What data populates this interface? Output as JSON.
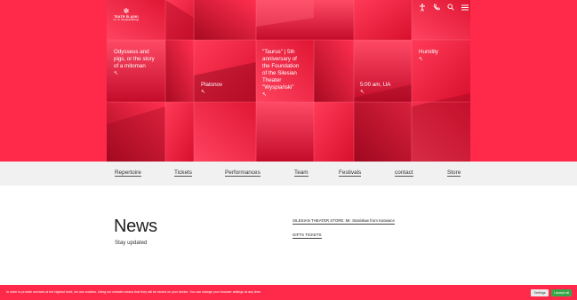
{
  "logo": {
    "line1": "TEATR ŚLĄSKI",
    "line2": "im. S. Wyspiańskiego"
  },
  "header_icons": [
    "accessibility-icon",
    "phone-icon",
    "search-icon",
    "menu-icon"
  ],
  "shows": [
    {
      "title": "Odysseus and pigs, or the story of a mitoman",
      "arrow": "↖"
    },
    {
      "title": "Platonov",
      "arrow": "↖"
    },
    {
      "title": "\"Taurus\" | 5th anniversary of the Foundation of the Silesian Theater \"Wyspiański\"",
      "arrow": "↖"
    },
    {
      "title": "5:00 am, UA",
      "arrow": "↖"
    },
    {
      "title": "Humility",
      "arrow": "↖"
    }
  ],
  "nav": [
    "Repertoire",
    "Tickets",
    "Performances",
    "Team",
    "Festivals",
    "contact",
    "Store"
  ],
  "news": {
    "title": "News",
    "subtitle": "Stay updated",
    "links": [
      "SILESIAN THEATER STORE: Mr. Stanisław from Katowice",
      "GIFTS TICKETS"
    ]
  },
  "cookie": {
    "text": "In order to provide services at the highest level, we use cookies. Using our website means that they will be stored on your device. You can change your browser settings at any time.",
    "settings": "Settings",
    "accept": "I accept all"
  },
  "colors": {
    "accent": "#ff2a4a",
    "nav_bg": "#f1f1f1",
    "accept": "#36a84a"
  }
}
